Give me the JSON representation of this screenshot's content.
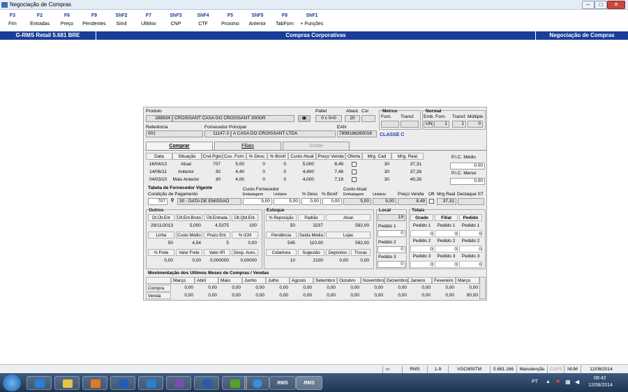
{
  "window": {
    "title": "Negociação de Compras"
  },
  "fkeys": [
    {
      "key": "F3",
      "label": "Fim"
    },
    {
      "key": "F2",
      "label": "Entradas"
    },
    {
      "key": "F6",
      "label": "Preço"
    },
    {
      "key": "F9",
      "label": "Pendentes"
    },
    {
      "key": "ShF2",
      "label": "Simil"
    },
    {
      "key": "F7",
      "label": "UltMov"
    },
    {
      "key": "ShF3",
      "label": "CNP"
    },
    {
      "key": "ShF4",
      "label": "CTF"
    },
    {
      "key": "F5",
      "label": "Proximo"
    },
    {
      "key": "ShF5",
      "label": "Anterior"
    },
    {
      "key": "F8",
      "label": "TabForn"
    },
    {
      "key": "ShF1",
      "label": "+ Funções"
    }
  ],
  "bluebar": {
    "left": "G-RMS Retail 5.681 BRE",
    "center": "Compras Corporativas",
    "right": "Negociação de Compras"
  },
  "produto": {
    "label": "Produto",
    "code": "288934",
    "name": "CROISSANT CASA DO CROISSANT 300GR",
    "pallet_label": "Pallet",
    "pallet": "0 x 0=0",
    "abast_label": "Abast.",
    "abast": "20",
    "cor_label": "Cor",
    "cor": "",
    "metros_label": "Metros",
    "forn_label": "Forn.",
    "transf_label": "Transf.",
    "normal_label": "Normal",
    "emb_forn_label": "Emb. Forn.",
    "transf2_label": "Transf.",
    "multiplo_label": "Múltiplo",
    "emb_unit": "UN",
    "emb_forn": "1",
    "transf": "1",
    "multiplo": "0",
    "referencia_label": "Referência",
    "referencia": "001",
    "fornecedor_label": "Fornecedor Principal",
    "fornecedor_code": "11147-3",
    "fornecedor_name": "A CASA DO CROISSANT LTDA",
    "ean_label": "EAN",
    "ean": "7898166260016",
    "classe": "CLASSE C"
  },
  "tabs": [
    "Comprar",
    "Filiais",
    "Grade"
  ],
  "hist": {
    "headers": [
      "Data",
      "Situação",
      "Cnd.Pgto",
      "Cus. Forn.",
      "% Desc",
      "% Bonif",
      "Custo Atual",
      "Preço Venda",
      "Oferta",
      "Mrg. Cad",
      "Mrg. Real"
    ],
    "rows": [
      [
        "16/04/13",
        "Atual",
        "707",
        "5,00",
        "0",
        "0",
        "5,000",
        "8,49",
        "",
        "30",
        "37,31"
      ],
      [
        "14/06/11",
        "Anterior",
        "30",
        "4,40",
        "0",
        "0",
        "4,400",
        "7,46",
        "",
        "30",
        "37,26"
      ],
      [
        "04/03/10",
        "Mais Anterior",
        "30",
        "4,00",
        "0",
        "0",
        "4,000",
        "7,19",
        "",
        "30",
        "40,26"
      ]
    ],
    "pic_medio_label": "P.I.C. Médio",
    "pic_medio": "0.00",
    "pic_menor_label": "P.I.C. Menor",
    "pic_menor": "0.00"
  },
  "tabela": {
    "title": "Tabela de Fornecedor Vigente",
    "cond_label": "Condição de Pagamento",
    "custo_forn_label": "Custo Fornecedor",
    "emb_label": "Embalagem",
    "unit_label": "Unitário",
    "desc_label": "% Desc",
    "bonif_label": "% Bonif",
    "custo_atual_label": "Custo Atual",
    "emb2_label": "Embalagem",
    "unit2_label": "Unitário",
    "pv_label": "Preço Venda",
    "oft_label": "Oft",
    "mrg_real_label": "Mrg Real",
    "destaque_label": "Destaque ST",
    "cond_code": "707",
    "cond_desc": "30 - DATA DE EMISSAO",
    "emb": "5,00",
    "unit": "5,00",
    "desc": "0,00",
    "bonif": "0,00",
    "ca_emb": "5,00",
    "ca_unit": "5,00",
    "pv": "8,49",
    "mrg": "37,31"
  },
  "outros": {
    "title": "Outros",
    "h1": [
      "Dt.Ült.Ent",
      "Ült.Ent.Bruto",
      "Ült.Entrada",
      "Ült.Qtd.Ent."
    ],
    "v1": [
      "29/11/2013",
      "5,000",
      "4,5375",
      "100"
    ],
    "h2": [
      "Linha",
      "Custo Médio",
      "Prazo Ent.",
      "% ICM"
    ],
    "v2": [
      "50",
      "4,54",
      "5",
      "0,00"
    ],
    "h3": [
      "% Frete",
      "Valor Frete",
      "Valor IPI",
      "Desp. Aces."
    ],
    "v3": [
      "0,00",
      "0,00",
      "0,000000",
      "0,00000"
    ]
  },
  "estoque": {
    "title": "Estoque",
    "h1": [
      "% Reposição",
      "Padrão",
      "Atual"
    ],
    "v1": [
      "50",
      "3237",
      "592,00"
    ],
    "h2": [
      "Pendência",
      "Saída Média",
      "Lojas"
    ],
    "v2": [
      "545",
      "110,00",
      "592,00"
    ],
    "h3": [
      "Cobertura",
      "Sugestão",
      "Depósitos",
      "Trocas"
    ],
    "v3": [
      "10",
      "2100",
      "0,00",
      "0,00"
    ]
  },
  "local": {
    "title": "Local",
    "value": "19",
    "p1": "Pedido 1",
    "v1": "0",
    "p2": "Pedido 2",
    "v2": "0",
    "p3": "Pedido 3",
    "v3": "0"
  },
  "totais": {
    "title": "Totais",
    "headers": [
      "Grade",
      "Filial",
      "Pedido"
    ],
    "rows": [
      [
        "Pedido 1",
        "Pedido 1",
        "Pedido 1"
      ],
      [
        "0",
        "0",
        "0"
      ],
      [
        "Pedido 2",
        "Pedido 2",
        "Pedido 2"
      ],
      [
        "0",
        "0",
        "0"
      ],
      [
        "Pedido 3",
        "Pedido 3",
        "Pedido 3"
      ],
      [
        "0",
        "0",
        "0"
      ]
    ]
  },
  "mov": {
    "title": "Movimentação dos Ultimos Meses de Compras / Vendas",
    "months": [
      "Março",
      "Abril",
      "Maio",
      "Junho",
      "Julho",
      "Agosto",
      "Setembro",
      "Outubro",
      "Novembro",
      "Dezembro",
      "Janeiro",
      "Fevereiro",
      "Março"
    ],
    "rows": [
      {
        "label": "Compra",
        "values": [
          "0,00",
          "0,00",
          "0,00",
          "0,00",
          "0,00",
          "0,00",
          "0,00",
          "0,00",
          "0,00",
          "0,00",
          "0,00",
          "0,00",
          "0,00"
        ]
      },
      {
        "label": "Venda",
        "values": [
          "0,00",
          "0,00",
          "0,00",
          "0,00",
          "0,00",
          "0,00",
          "0,00",
          "0,00",
          "0,00",
          "0,00",
          "0,00",
          "0,00",
          "90,00"
        ]
      }
    ]
  },
  "status": [
    "RMS",
    "1-9",
    "VGCMSITM",
    "5.681.166",
    "Manutenção",
    "CAPS",
    "NUM",
    "12/08/2014"
  ],
  "taskbar": {
    "lang": "PT",
    "time": "08:42",
    "date": "12/08/2014",
    "rms1": "RMS",
    "rms2": "RMS"
  },
  "colors": {
    "blue": "#1a3d9a",
    "classe": "#1a3dc0"
  }
}
